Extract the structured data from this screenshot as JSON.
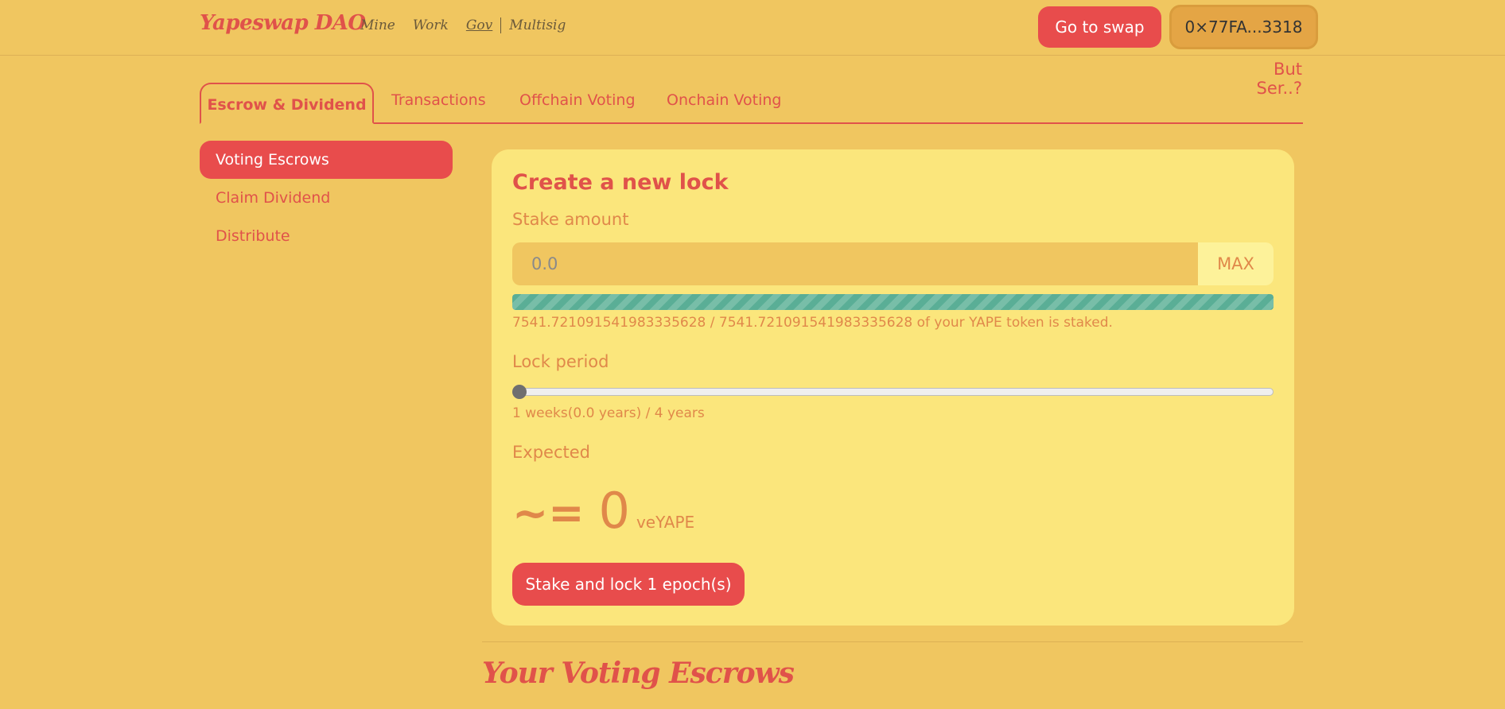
{
  "header": {
    "brand": "Yapeswap DAO",
    "nav": [
      "Mine",
      "Work",
      "Gov",
      "Multisig"
    ],
    "swap_button": "Go to swap",
    "wallet": "0×77FA...3318",
    "help_link": "But Ser..?"
  },
  "tabs": [
    {
      "label": "Escrow & Dividend",
      "active": true
    },
    {
      "label": "Transactions",
      "active": false
    },
    {
      "label": "Offchain Voting",
      "active": false
    },
    {
      "label": "Onchain Voting",
      "active": false
    }
  ],
  "sidebar": {
    "items": [
      {
        "label": "Voting Escrows",
        "active": true
      },
      {
        "label": "Claim Dividend",
        "active": false
      },
      {
        "label": "Distribute",
        "active": false
      }
    ]
  },
  "lock_card": {
    "title": "Create a new lock",
    "stake_label": "Stake amount",
    "stake_placeholder": "0.0",
    "max_label": "MAX",
    "staked_progress": 1.0,
    "staked_note": "7541.721091541983335628 / 7541.721091541983335628 of your YAPE token is staked.",
    "lock_period_label": "Lock period",
    "lock_period_value": 0,
    "lock_period_note": "1 weeks(0.0 years) / 4 years",
    "expected_label": "Expected",
    "expected_approx": "~=",
    "expected_value": "0",
    "expected_unit": "veYAPE",
    "submit_label": "Stake and lock 1 epoch(s)"
  },
  "escrows_section": {
    "title": "Your Voting Escrows"
  },
  "colors": {
    "background": "#f0c660",
    "accent": "#e84c4c",
    "card": "#fbe67c",
    "progress": "#5aae96"
  }
}
